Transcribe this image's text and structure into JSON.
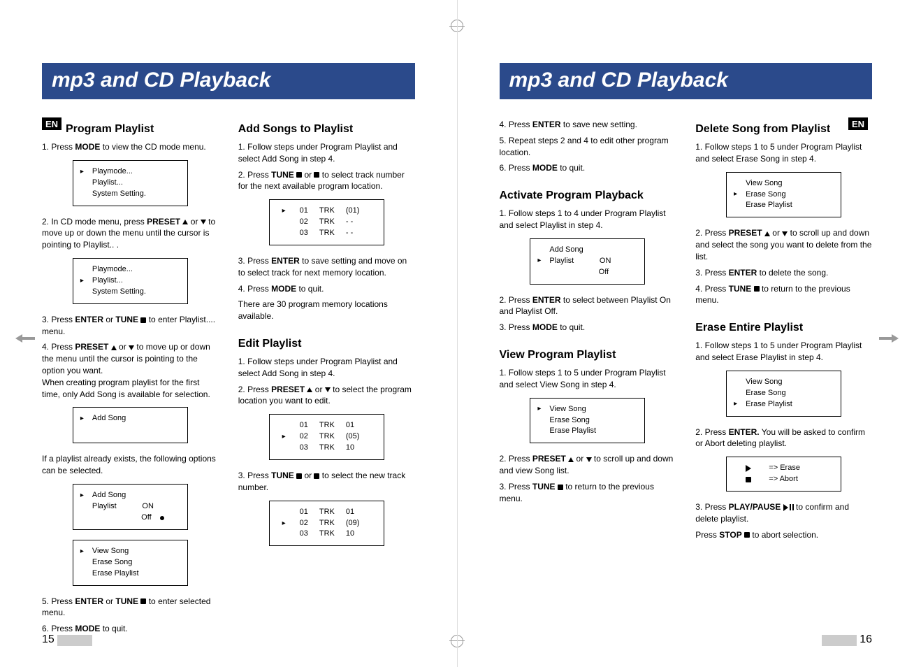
{
  "left": {
    "title": "mp3 and CD Playback",
    "enBadge": "EN",
    "pageNumber": "15",
    "col1": {
      "h1": "Program Playlist",
      "p1a": "1.  Press ",
      "p1b": "MODE",
      "p1c": " to view the CD mode menu.",
      "box1": [
        "Playmode...",
        "Playlist...",
        "System Setting."
      ],
      "box1cursor": 0,
      "p2a": "2.  In CD mode menu, press ",
      "p2b": "PRESET",
      "p2c": "   or   to move up or down the menu until the cursor is pointing to Playlist.. .",
      "box2": [
        "Playmode...",
        "Playlist...",
        "System Setting."
      ],
      "box2cursor": 1,
      "p3a": "3.  Press ",
      "p3b": "ENTER",
      "p3c": " or ",
      "p3d": "TUNE",
      "p3e": "   to enter Playlist.... menu.",
      "p4a": "4.  Press ",
      "p4b": "PRESET",
      "p4c": "   or   to move up or down the menu until the cursor is pointing to  the option you want.",
      "p4d": "When creating program playlist for the first time, only Add Song is available for selection.",
      "box3": [
        "Add Song"
      ],
      "box3cursor": 0,
      "p5": "If  a playlist already exists, the following options can be selected.",
      "box4": [
        "Add Song",
        "Playlist            ON",
        "                       Off"
      ],
      "box4cursor": 0,
      "box4dot": 2,
      "box5": [
        "View Song",
        "Erase Song",
        "Erase Playlist"
      ],
      "box5cursor": 0,
      "p6a": "5.  Press ",
      "p6b": "ENTER",
      "p6c": " or ",
      "p6d": "TUNE",
      "p6e": "   to enter selected menu.",
      "p7a": "6.  Press ",
      "p7b": "MODE",
      "p7c": " to quit."
    },
    "col2": {
      "h1": "Add Songs to Playlist",
      "p1": "1.  Follow steps under Program Playlist and select Add Song in step  4.",
      "p2a": "2.  Press ",
      "p2b": "TUNE",
      "p2c": "   or   to select track number for the next available program location.",
      "boxA": [
        [
          "01",
          "TRK",
          "(01)"
        ],
        [
          "02",
          "TRK",
          "- -"
        ],
        [
          "03",
          "TRK",
          "- -"
        ]
      ],
      "boxAcursor": 0,
      "p3a": "3. Press ",
      "p3b": "ENTER",
      "p3c": " to save setting and move on to  select track for next memory location.",
      "p4a": "4. Press ",
      "p4b": "MODE",
      "p4c": " to quit.",
      "p5": "There are 30 program memory locations available.",
      "h2": "Edit Playlist",
      "p6": "1.  Follow steps under Program Playlist and select Add Song in step  4.",
      "p7a": "2.  Press ",
      "p7b": "PRESET",
      "p7c": "   or   to select the program location you want to edit.",
      "boxB": [
        [
          "01",
          "TRK",
          "01"
        ],
        [
          "02",
          "TRK",
          "(05)"
        ],
        [
          "03",
          "TRK",
          "10"
        ]
      ],
      "boxBcursor": 1,
      "p8a": "3.  Press ",
      "p8b": "TUNE",
      "p8c": "   or   to select the new track number.",
      "boxC": [
        [
          "01",
          "TRK",
          "01"
        ],
        [
          "02",
          "TRK",
          "(09)"
        ],
        [
          "03",
          "TRK",
          "10"
        ]
      ],
      "boxCcursor": 1
    }
  },
  "right": {
    "title": "mp3 and CD Playback",
    "enBadge": "EN",
    "pageNumber": "16",
    "col1": {
      "p1a": "4.  Press ",
      "p1b": "ENTER",
      "p1c": " to save new setting.",
      "p2": "5.  Repeat steps 2 and 4 to edit other program location.",
      "p3a": "6.  Press ",
      "p3b": "MODE",
      "p3c": " to quit.",
      "h1": "Activate Program Playback",
      "p4": "1.  Follow steps 1 to 4 under Program Playlist and select Playlist in step  4.",
      "box1": [
        "Add Song",
        "Playlist            ON",
        "                       Off"
      ],
      "box1cursor": 1,
      "p5a": "2.  Press ",
      "p5b": "ENTER",
      "p5c": "  to select between Playlist On and Playlist Off.",
      "p6a": "3. Press ",
      "p6b": "MODE",
      "p6c": " to quit.",
      "h2": "View Program Playlist",
      "p7": "1.  Follow steps 1 to 5 under Program Playlist and select View Song in step  4.",
      "box2": [
        "View Song",
        "Erase Song",
        "Erase Playlist"
      ],
      "box2cursor": 0,
      "p8a": "2. Press ",
      "p8b": "PRESET",
      "p8c": "   or   to scroll up and down and view Song list.",
      "p9a": "3. Press ",
      "p9b": "TUNE",
      "p9c": "   to return to the previous menu."
    },
    "col2": {
      "h1": "Delete Song from Playlist",
      "p1": "1.  Follow steps 1 to 5 under Program Playlist and select Erase  Song in step  4.",
      "box1": [
        "View Song",
        "Erase Song",
        "Erase Playlist"
      ],
      "box1cursor": 1,
      "p2a": "2. Press ",
      "p2b": "PRESET",
      "p2c": "   or   to scroll up and down and select the song you want to delete from the list.",
      "p3a": "3.  Press ",
      "p3b": "ENTER",
      "p3c": " to delete the song.",
      "p4a": "4. Press ",
      "p4b": "TUNE",
      "p4c": "   to return to the previous menu.",
      "h2": "Erase Entire Playlist",
      "p5": "1.  Follow steps 1 to 5 under Program Playlist and select Erase  Playlist in step  4.",
      "box2": [
        "View Song",
        "Erase Song",
        "Erase Playlist"
      ],
      "box2cursor": 2,
      "p6a": "2. Press ",
      "p6b": "ENTER.",
      "p6c": "  You will be asked to confirm or Abort deleting playlist.",
      "box3line1": "=> Erase",
      "box3line2": "=> Abort",
      "p7a": "3.  Press ",
      "p7b": "PLAY/PAUSE",
      "p7c": "   to confirm and delete playlist.",
      "p8a": "Press ",
      "p8b": "STOP",
      "p8c": "   to abort selection."
    }
  }
}
